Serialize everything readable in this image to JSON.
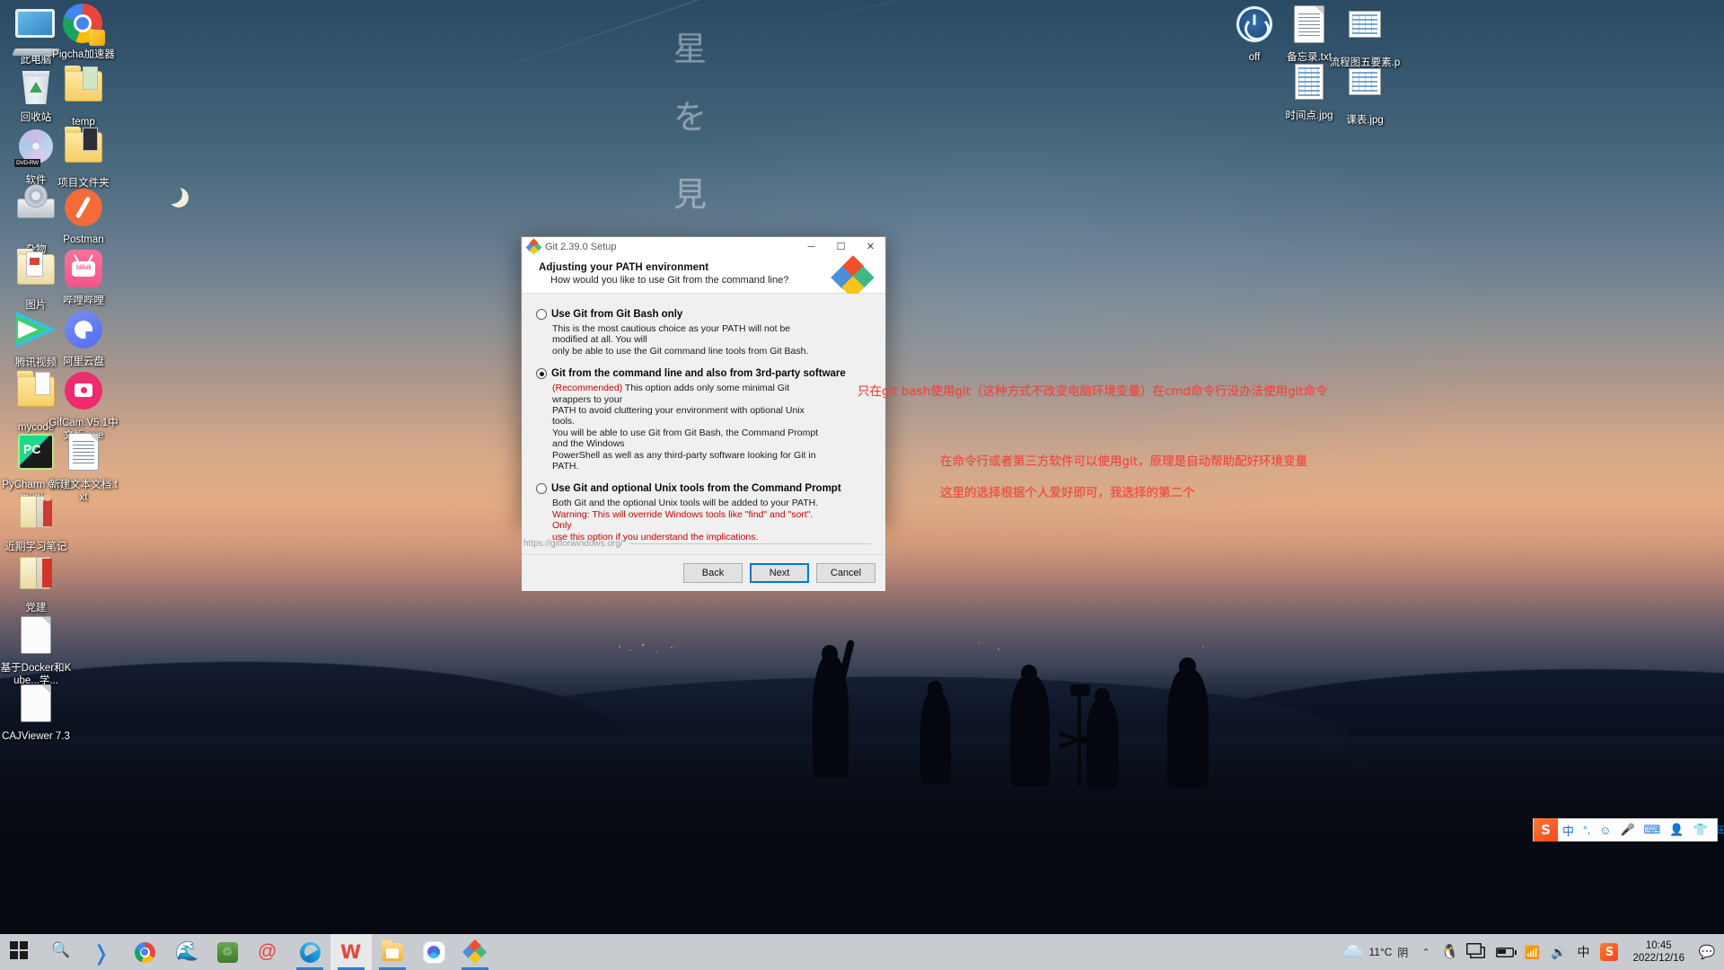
{
  "desktop": {
    "wallpaper_kanji": [
      "星",
      "を",
      "見"
    ],
    "icons_left": [
      {
        "label": "此电脑",
        "icon": "computer-icon"
      },
      {
        "label": "Pigcha加速器",
        "icon": "pigcha-accelerator-icon"
      },
      {
        "label": "回收站",
        "icon": "recycle-bin-icon"
      },
      {
        "label": "temp",
        "icon": "folder-icon"
      },
      {
        "label": "软件",
        "icon": "dvd-drive-icon"
      },
      {
        "label": "项目文件夹",
        "icon": "folder-icon"
      },
      {
        "label": "杂物",
        "icon": "disk-drive-icon"
      },
      {
        "label": "Postman",
        "icon": "postman-icon"
      },
      {
        "label": "图片",
        "icon": "pictures-folder-icon"
      },
      {
        "label": "哔哩哔哩",
        "icon": "bilibili-icon"
      },
      {
        "label": "腾讯视频",
        "icon": "tencent-video-icon"
      },
      {
        "label": "阿里云盘",
        "icon": "aliyun-drive-icon"
      },
      {
        "label": "mycode",
        "icon": "folder-icon"
      },
      {
        "label": "GifCam.V5.1中文版.exe",
        "icon": "gifcam-icon"
      },
      {
        "label": "PyCharm Communi...",
        "icon": "pycharm-icon"
      },
      {
        "label": "新建文本文档.txt",
        "icon": "text-document-icon"
      },
      {
        "label": "近期学习笔记",
        "icon": "notes-folder-icon"
      },
      {
        "label": "党建",
        "icon": "folder-icon"
      },
      {
        "label": "基于Docker和Kube...学...",
        "icon": "document-icon"
      },
      {
        "label": "CAJViewer 7.3",
        "icon": "document-icon"
      }
    ],
    "icons_right": [
      {
        "label": "off",
        "icon": "power-icon"
      },
      {
        "label": "备忘录.txt",
        "icon": "text-document-icon"
      },
      {
        "label": "流程图五要素.png",
        "icon": "image-file-icon"
      },
      {
        "label": "时间点.jpg",
        "icon": "image-file-icon"
      },
      {
        "label": "课表.jpg",
        "icon": "image-file-icon"
      }
    ]
  },
  "dialog": {
    "title": "Git 2.39.0 Setup",
    "minimize": "─",
    "maximize": "☐",
    "close": "✕",
    "heading": "Adjusting your PATH environment",
    "subheading": "How would you like to use Git from the command line?",
    "options": [
      {
        "title": "Use Git from Git Bash only",
        "selected": false,
        "desc_line1": "This is the most cautious choice as your PATH will not be modified at all. You will",
        "desc_line2": "only be able to use the Git command line tools from Git Bash."
      },
      {
        "title": "Git from the command line and also from 3rd-party software",
        "selected": true,
        "recommended_tag": "(Recommended)",
        "desc_line1": " This option adds only some minimal Git wrappers to your",
        "desc_line2": "PATH to avoid cluttering your environment with optional Unix tools.",
        "desc_line3": "You will be able to use Git from Git Bash, the Command Prompt and the Windows",
        "desc_line4": "PowerShell as well as any third-party software looking for Git in PATH."
      },
      {
        "title": "Use Git and optional Unix tools from the Command Prompt",
        "selected": false,
        "desc_line1": "Both Git and the optional Unix tools will be added to your PATH.",
        "warn_line1": "Warning: This will override Windows tools like \"find\" and \"sort\". Only",
        "warn_line2": "use this option if you understand the implications."
      }
    ],
    "url": "https://gitforwindows.org/",
    "buttons": {
      "back": "Back",
      "next": "Next",
      "cancel": "Cancel"
    }
  },
  "annotations": [
    "只在git bash使用git（这种方式不改变电脑环境变量）在cmd命令行没办法使用git命令",
    "在命令行或者第三方软件可以使用git，原理是自动帮助配好环境变量",
    "这里的选择根据个人爱好即可，我选择的第二个"
  ],
  "ime_bar": {
    "logo": "S",
    "items": [
      "中",
      "°,",
      "☺",
      "Ἲ4",
      "⌨",
      "὆4",
      "ὅ5",
      "⊞"
    ]
  },
  "taskbar": {
    "left_items": [
      {
        "name": "start-button",
        "icon": "windows-start-icon",
        "label": ""
      },
      {
        "name": "search-button",
        "icon": "search-icon",
        "label": ""
      },
      {
        "name": "vscode-button",
        "icon": "vscode-icon",
        "label": ""
      },
      {
        "name": "chrome-button",
        "icon": "chrome-icon",
        "label": ""
      },
      {
        "name": "navicat-button",
        "icon": "navicat-icon",
        "label": ""
      },
      {
        "name": "env-button",
        "icon": "environment-icon",
        "label": ""
      },
      {
        "name": "snail-button",
        "icon": "snail-icon",
        "label": ""
      },
      {
        "name": "edge-button",
        "icon": "edge-icon",
        "label": ""
      },
      {
        "name": "wps-button",
        "icon": "wps-icon",
        "label": ""
      },
      {
        "name": "explorer-button",
        "icon": "file-explorer-icon",
        "label": ""
      },
      {
        "name": "baidu-disk-button",
        "icon": "cloud-disk-icon",
        "label": ""
      },
      {
        "name": "git-setup-button",
        "icon": "git-icon",
        "label": ""
      }
    ],
    "tray": {
      "temperature": "11°C",
      "weather": "阴",
      "chevron": "⌃",
      "ime_indicator": "中",
      "sougou": "S",
      "time": "10:45",
      "date": "2022/12/16"
    }
  }
}
